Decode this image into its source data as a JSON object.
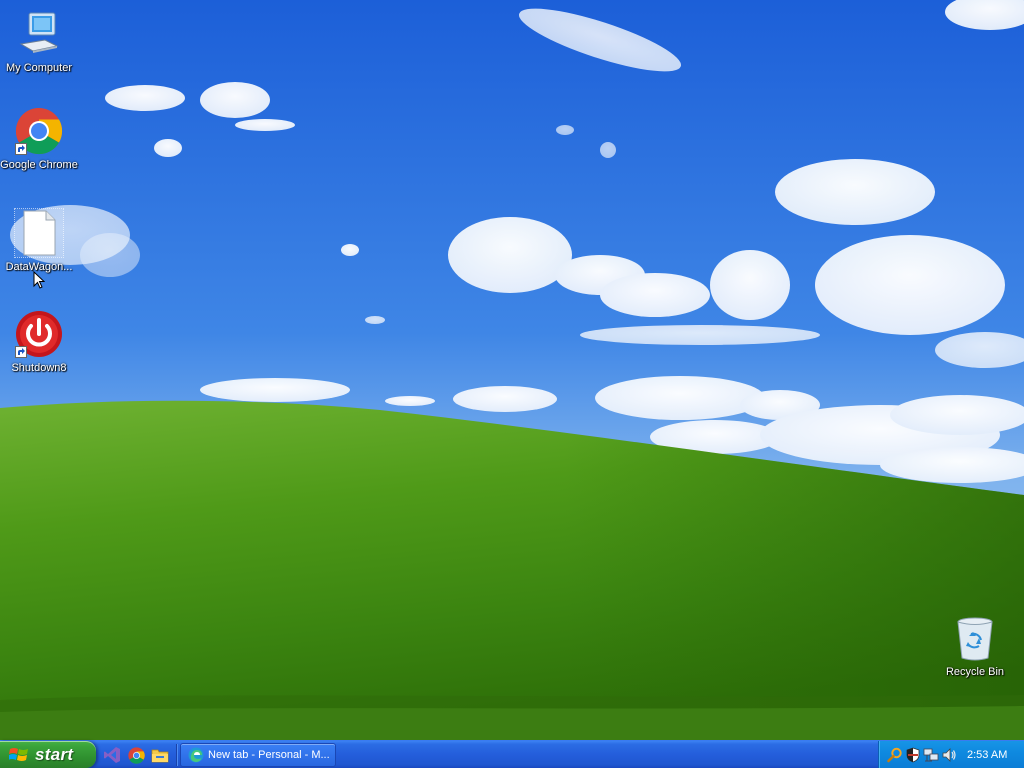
{
  "desktop": {
    "icons": [
      {
        "id": "my-computer",
        "label": "My Computer"
      },
      {
        "id": "google-chrome",
        "label": "Google Chrome"
      },
      {
        "id": "datawagon",
        "label": "DataWagon..."
      },
      {
        "id": "shutdown8",
        "label": "Shutdown8"
      },
      {
        "id": "recycle-bin",
        "label": "Recycle Bin"
      }
    ]
  },
  "taskbar": {
    "start_label": "start",
    "quick_launch": [
      "visual-studio-icon",
      "chrome-icon",
      "file-explorer-icon"
    ],
    "tasks": [
      {
        "label": "New tab - Personal - M...",
        "icon": "edge-icon"
      }
    ],
    "tray": {
      "icons": [
        "search-magnifier-icon",
        "security-shield-icon",
        "network-icon",
        "volume-icon"
      ],
      "clock": "2:53 AM"
    }
  },
  "colors": {
    "taskbar_blue": "#245edb",
    "start_green": "#3aa33a",
    "tray_blue": "#0f8ae0"
  }
}
